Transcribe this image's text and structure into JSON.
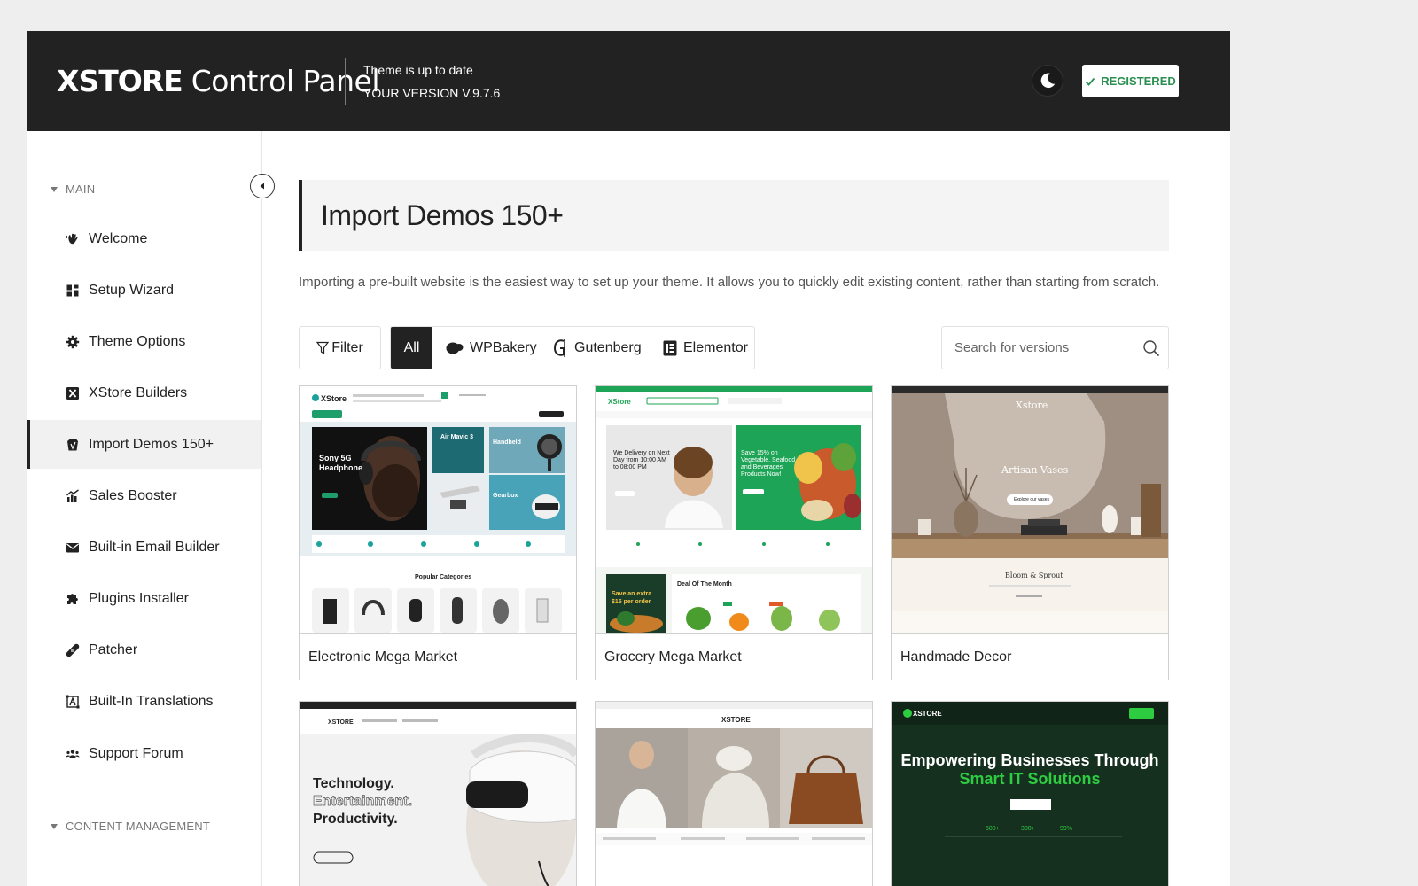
{
  "header": {
    "brand": "XSTORE",
    "title_rest": " Control Panel",
    "status": "Theme is up to date",
    "version": "YOUR VERSION V.9.7.6",
    "registered_label": "REGISTERED"
  },
  "sidebar": {
    "main_heading": "MAIN",
    "items": [
      {
        "label": "Welcome",
        "icon": "hand-wave-icon"
      },
      {
        "label": "Setup Wizard",
        "icon": "grid-icon"
      },
      {
        "label": "Theme Options",
        "icon": "gear-icon"
      },
      {
        "label": "XStore Builders",
        "icon": "x-box-icon"
      },
      {
        "label": "Import Demos 150+",
        "icon": "import-icon"
      },
      {
        "label": "Sales Booster",
        "icon": "chart-icon"
      },
      {
        "label": "Built-in Email Builder",
        "icon": "envelope-icon"
      },
      {
        "label": "Plugins Installer",
        "icon": "puzzle-icon"
      },
      {
        "label": "Patcher",
        "icon": "bandage-icon"
      },
      {
        "label": "Built-In Translations",
        "icon": "translate-icon"
      },
      {
        "label": "Support Forum",
        "icon": "users-icon"
      }
    ],
    "content_heading": "CONTENT MANAGEMENT"
  },
  "main": {
    "title": "Import Demos 150+",
    "description": "Importing a pre-built website is the easiest way to set up your theme. It allows you to quickly edit existing content, rather than starting from scratch.",
    "filter_label": "Filter",
    "builders": [
      "All",
      "WPBakery",
      "Gutenberg",
      "Elementor"
    ],
    "search_placeholder": "Search for versions"
  },
  "demos": [
    {
      "name": "Electronic Mega Market",
      "preview": {
        "logo": "XStore",
        "hero": "Sony 5G Headphone",
        "promo1": "Air Mavic 3",
        "promo2": "Handheld",
        "promo3": "Gearbox",
        "section": "Popular Categories"
      }
    },
    {
      "name": "Grocery Mega Market",
      "preview": {
        "logo": "XStore",
        "hero": "We Delivery on Next Day from 10:00 AM to 08:00 PM",
        "promo": "Save 15% on Vegetable, Seafood and Beverages Products Now!",
        "deal_tag": "Save an extra $15 per order",
        "section": "Deal Of The Month"
      }
    },
    {
      "name": "Handmade Decor",
      "preview": {
        "logo": "Xstore",
        "hero": "Artisan Vases",
        "button": "Explore our vases",
        "subtitle": "Bloom & Sprout"
      }
    },
    {
      "name": "",
      "preview": {
        "logo": "XSTORE",
        "line1": "Technology.",
        "line2": "Entertainment.",
        "line3": "Productivity."
      }
    },
    {
      "name": "",
      "preview": {
        "logo": "XSTORE"
      }
    },
    {
      "name": "",
      "preview": {
        "logo": "XSTORE",
        "line1": "Empowering Businesses Through",
        "line2": "Smart IT Solutions",
        "stat1": "500+",
        "stat2": "300+",
        "stat3": "99%"
      }
    }
  ],
  "colors": {
    "header_bg": "#222222",
    "registered_green": "#2a8f50",
    "grocery_green": "#1ea456",
    "it_green": "#2ecc40"
  }
}
